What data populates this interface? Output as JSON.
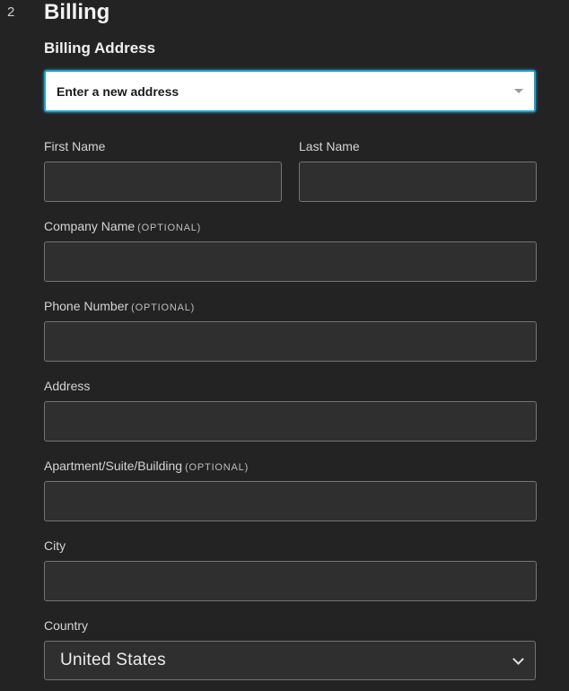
{
  "step": {
    "number": "2",
    "title": "Billing"
  },
  "billing_address": {
    "heading": "Billing Address",
    "selector_value": "Enter a new address"
  },
  "fields": {
    "first_name": {
      "label": "First Name",
      "value": ""
    },
    "last_name": {
      "label": "Last Name",
      "value": ""
    },
    "company": {
      "label": "Company Name",
      "optional": "(OPTIONAL)",
      "value": ""
    },
    "phone": {
      "label": "Phone Number",
      "optional": "(OPTIONAL)",
      "value": ""
    },
    "address": {
      "label": "Address",
      "value": ""
    },
    "apartment": {
      "label": "Apartment/Suite/Building",
      "optional": "(OPTIONAL)",
      "value": ""
    },
    "city": {
      "label": "City",
      "value": ""
    },
    "country": {
      "label": "Country",
      "value": "United States"
    }
  },
  "colors": {
    "background": "#232323",
    "input_background": "#2f2f2f",
    "focus_border": "#1fa3c8"
  }
}
